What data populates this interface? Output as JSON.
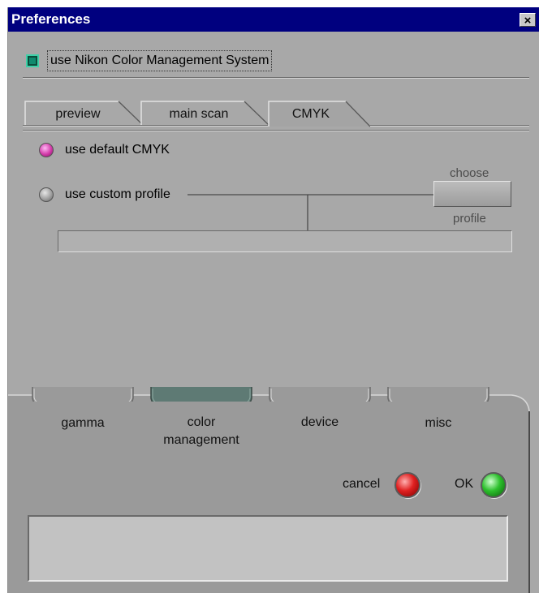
{
  "window": {
    "title": "Preferences",
    "close_glyph": "×"
  },
  "cms": {
    "label": "use Nikon Color Management System",
    "checked": true
  },
  "tabs": [
    {
      "label": "preview",
      "active": false
    },
    {
      "label": "main scan",
      "active": false
    },
    {
      "label": "CMYK",
      "active": true
    }
  ],
  "cmyk": {
    "default_label": "use default CMYK",
    "default_selected": true,
    "custom_label": "use custom profile",
    "custom_selected": false,
    "choose_top": "choose",
    "choose_bottom": "profile",
    "profile_path": ""
  },
  "categories": [
    {
      "label": "gamma",
      "active": false
    },
    {
      "label": "color\nmanagement",
      "active": true
    },
    {
      "label": "device",
      "active": false
    },
    {
      "label": "misc",
      "active": false
    }
  ],
  "buttons": {
    "cancel": "cancel",
    "ok": "OK"
  },
  "message": "",
  "colors": {
    "titlebar": "#00007f",
    "panel": "#a8a8a8",
    "active_category": "#5e7a74",
    "cms_check": "#0f8a6e"
  }
}
